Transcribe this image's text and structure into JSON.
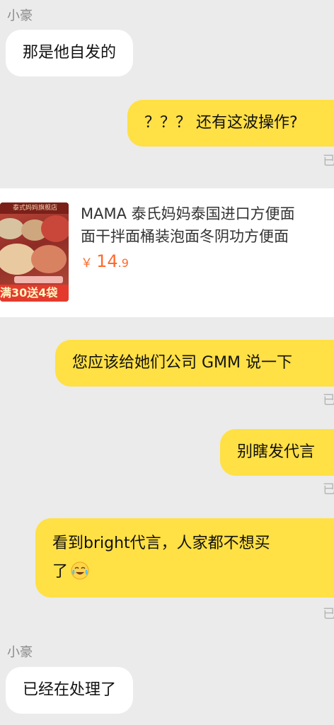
{
  "messages": [
    {
      "sender": "小豪",
      "text": "那是他自发的"
    },
    {
      "text": "？？？ 还有这波操作?",
      "status": "已读"
    },
    {
      "text": "您应该给她们公司 GMM 说一下",
      "status": "已读"
    },
    {
      "text": "别瞎发代言",
      "status": "已读"
    },
    {
      "text_line1": "看到bright代言，人家都不想买",
      "text_line2": "了",
      "status": "已读"
    },
    {
      "sender": "小豪",
      "text": "已经在处理了"
    }
  ],
  "product": {
    "title_line1": "MAMA 泰氏妈妈泰国进口方便面",
    "title_line2": "面干拌面桶装泡面冬阴功方便面",
    "currency": "￥",
    "price_int": "14",
    "price_dec": ".9",
    "shop_label": "泰式妈妈旗舰店",
    "promo": "满30送4袋"
  },
  "icons": {
    "emoji": "tears-of-joy-emoji"
  },
  "colors": {
    "background": "#ebebeb",
    "incoming_bubble": "#ffffff",
    "outgoing_bubble": "#ffe045",
    "price": "#ff6a2c"
  }
}
